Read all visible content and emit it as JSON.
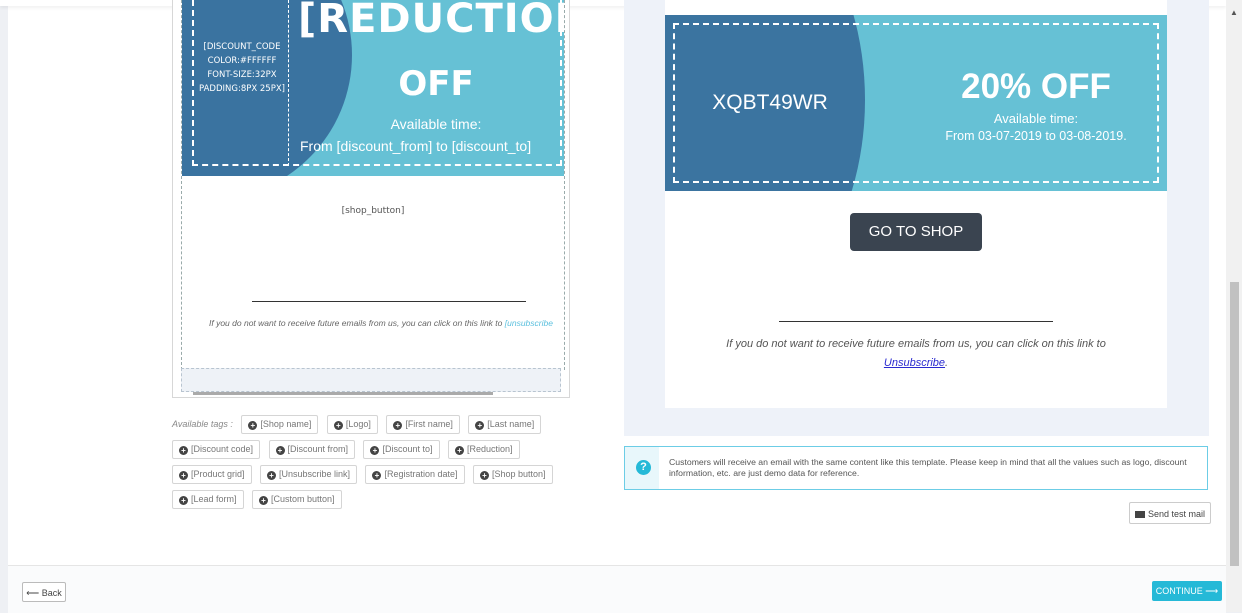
{
  "editor": {
    "discount_code_tag": "[DISCOUNT_CODE COLOR:#FFFFFF FONT-SIZE:32PX PADDING:8PX 25PX]",
    "reduction_tag": "[REDUCTION",
    "off": "OFF",
    "available": "Available time:",
    "from_to": "From [discount_from] to [discount_to]",
    "shop_button_tag": "[shop_button]",
    "unsubscribe_text": "If you do not want to receive future emails from us, you can click on this link to",
    "unsubscribe_link": "[unsubscribe"
  },
  "tags": {
    "label": "Available tags :",
    "items": [
      "[Shop name]",
      "[Logo]",
      "[First name]",
      "[Last name]",
      "[Discount code]",
      "[Discount from]",
      "[Discount to]",
      "[Reduction]",
      "[Product grid]",
      "[Unsubscribe link]",
      "[Registration date]",
      "[Shop button]",
      "[Lead form]",
      "[Custom button]"
    ]
  },
  "preview": {
    "code": "XQBT49WR",
    "off": "20% OFF",
    "available": "Available time:",
    "from_to": "From 03-07-2019 to 03-08-2019.",
    "button": "GO TO SHOP",
    "unsub_text": "If you do not want to receive future emails from us, you can click on this link to",
    "unsub_link": "Unsubscribe",
    "unsub_end": "."
  },
  "info": {
    "text": "Customers will receive an email with the same content like this template. Please keep in mind that all the values such as logo, discount information, etc. are just demo data for reference."
  },
  "actions": {
    "send_test": "Send test mail",
    "back": "Back",
    "continue": "CONTINUE"
  },
  "colors": {
    "banner_light": "#66c1d5",
    "banner_dark": "#3b74a0",
    "button_dark": "#3a4450",
    "accent": "#25b9d7"
  }
}
